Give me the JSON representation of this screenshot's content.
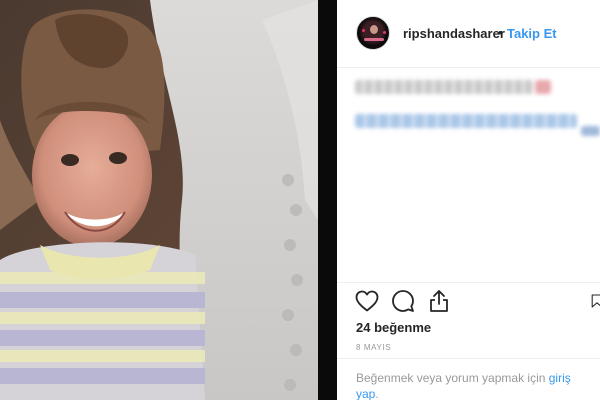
{
  "post": {
    "username": "ripshandasharer",
    "separator": "•",
    "follow_label": "Takip Et",
    "likes_count": "24 beğenme",
    "date": "8 MAYIS",
    "login_prompt_prefix": "Beğenmek veya yorum yapmak için ",
    "login_link": "giriş yap",
    "login_prompt_suffix": "."
  },
  "icons": {
    "like": "heart-outline-icon",
    "comment": "speech-bubble-icon",
    "share": "share-upload-icon",
    "save": "bookmark-icon"
  },
  "colors": {
    "link_blue": "#3897f0",
    "text_primary": "#262626",
    "text_muted": "#999999",
    "divider": "#efefef"
  }
}
